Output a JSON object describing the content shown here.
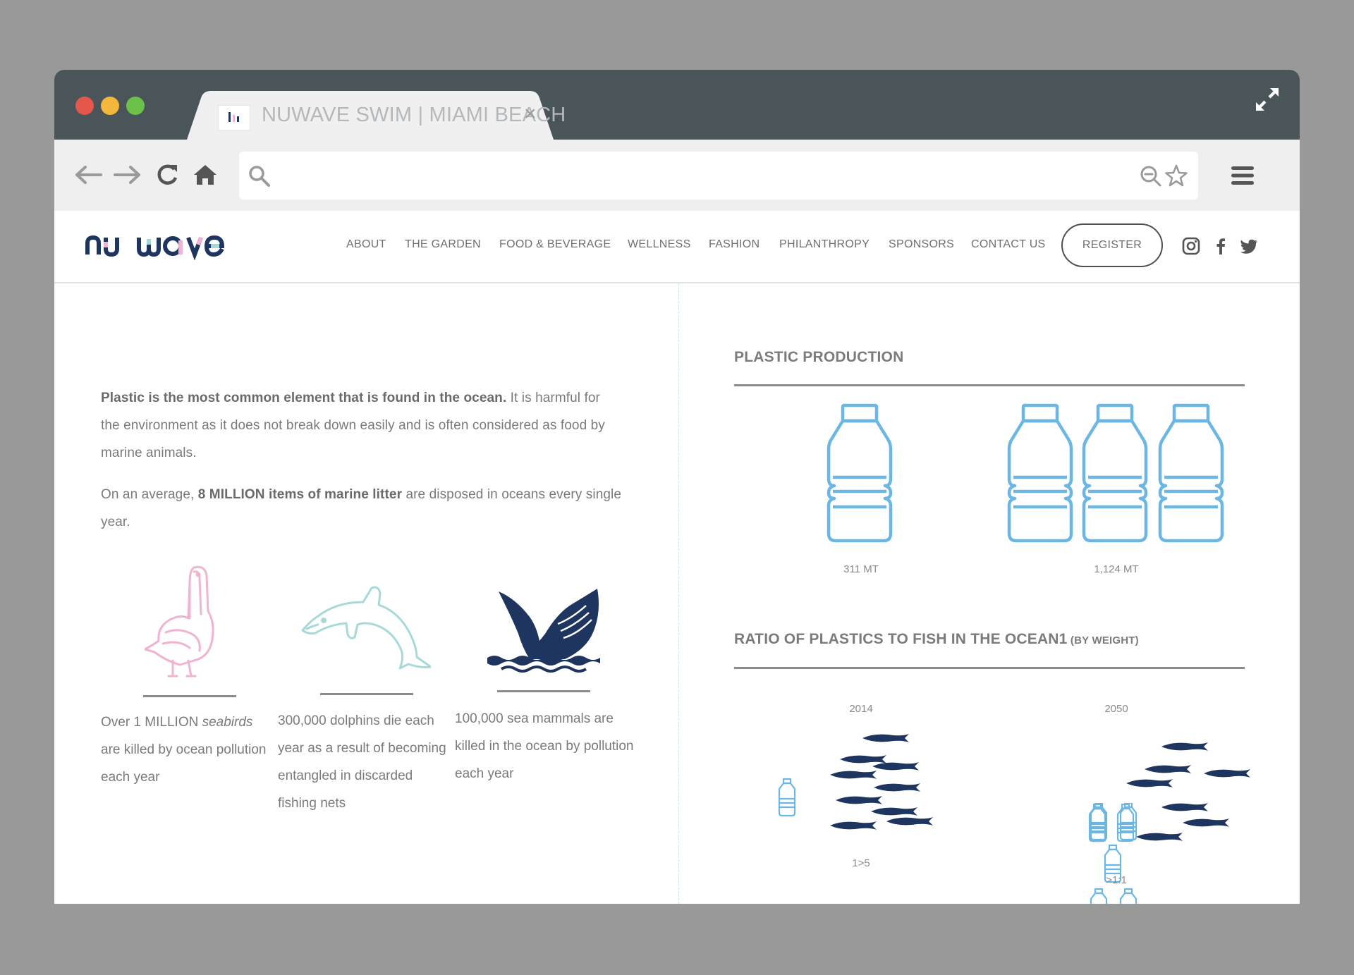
{
  "browser": {
    "tab_title": "NUWAVE SWIM | MIAMI BEACH",
    "tab_close": "×",
    "url": "",
    "window_dots": [
      "#e4574a",
      "#f3b73b",
      "#6cc14a"
    ]
  },
  "site": {
    "logo_text": "nu wave",
    "nav": [
      "ABOUT",
      "THE GARDEN",
      "FOOD & BEVERAGE",
      "WELLNESS",
      "FASHION",
      "PHILANTHROPY",
      "SPONSORS",
      "CONTACT US"
    ],
    "register_label": "REGISTER",
    "social_icons": [
      "instagram-icon",
      "facebook-icon",
      "twitter-icon"
    ]
  },
  "left": {
    "intro_bold": "Plastic is the most common element that is found in the ocean.",
    "intro_rest": " It is harmful for the environment as it does not break down easily and is often considered as food by marine animals.",
    "avg_pre": "On an average, ",
    "avg_bold": "8 MILLION items of marine litter",
    "avg_post": " are disposed in oceans every single year.",
    "stats": [
      {
        "icon": "pelican-icon",
        "pre": "Over 1 MILLION ",
        "em": "seabirds",
        "post": " are killed by ocean pollution each year"
      },
      {
        "icon": "dolphin-icon",
        "pre": "300,000 dolphins die each year as a result of becoming entangled in discarded fishing nets",
        "em": "",
        "post": ""
      },
      {
        "icon": "whale-icon",
        "pre": "100,000 sea mammals are killed in the ocean by pollution each year",
        "em": "",
        "post": ""
      }
    ]
  },
  "right": {
    "production_title": "PLASTIC PRODUCTION",
    "production": [
      {
        "label": "311 MT",
        "bottles": 1
      },
      {
        "label": "1,124 MT",
        "bottles": 3
      }
    ],
    "ratio_title": "RATIO OF PLASTICS TO FISH IN THE OCEAN1",
    "ratio_title_small": " (BY WEIGHT)",
    "ratio": [
      {
        "year": "2014",
        "label": "1>5",
        "bottles": 1,
        "fish": 9
      },
      {
        "year": "2050",
        "label": ">1:1",
        "bottles": 6,
        "fish": 7
      }
    ]
  },
  "colors": {
    "bottle_blue": "#6cb6e3",
    "fish_navy": "#1e3560",
    "pelican_pink": "#f0b3d2",
    "dolphin_teal": "#a7d9d9",
    "whale_navy": "#1e3560"
  }
}
